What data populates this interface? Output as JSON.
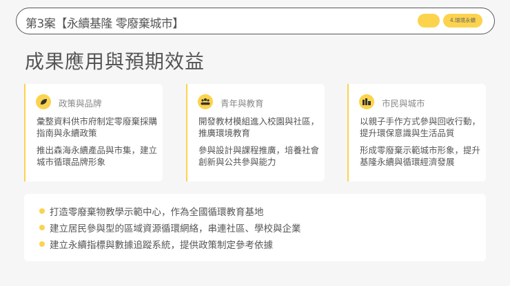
{
  "header": {
    "title": "第3案【永續基隆 零廢棄城市】",
    "tag": "4.環境永續"
  },
  "main_title": "成果應用與預期效益",
  "cards": [
    {
      "icon": "leaf-icon",
      "heading": "政策與品牌",
      "paragraphs": [
        "彙整資料供市府制定零廢棄採購指南與永續政策",
        "推出森海永續產品與市集，建立城市循環品牌形象"
      ]
    },
    {
      "icon": "users-icon",
      "heading": "青年與教育",
      "paragraphs": [
        "開發教材模組進入校園與社區，推廣環境教育",
        "參與設計與課程推廣，培養社會創新與公共參與能力"
      ]
    },
    {
      "icon": "city-icon",
      "heading": "市民與城市",
      "paragraphs": [
        "以親子手作方式參與回收行動，提升環保意識與生活品質",
        "形成零廢棄示範城市形象，提升基隆永續與循環經濟發展"
      ]
    }
  ],
  "bullets": [
    "打造零廢棄物教學示範中心，作為全國循環教育基地",
    "建立居民參與型的區域資源循環網絡，串連社區、學校與企業",
    "建立永續指標與數據追蹤系統，提供政策制定參考依據"
  ],
  "colors": {
    "accent": "#fcd34d"
  }
}
